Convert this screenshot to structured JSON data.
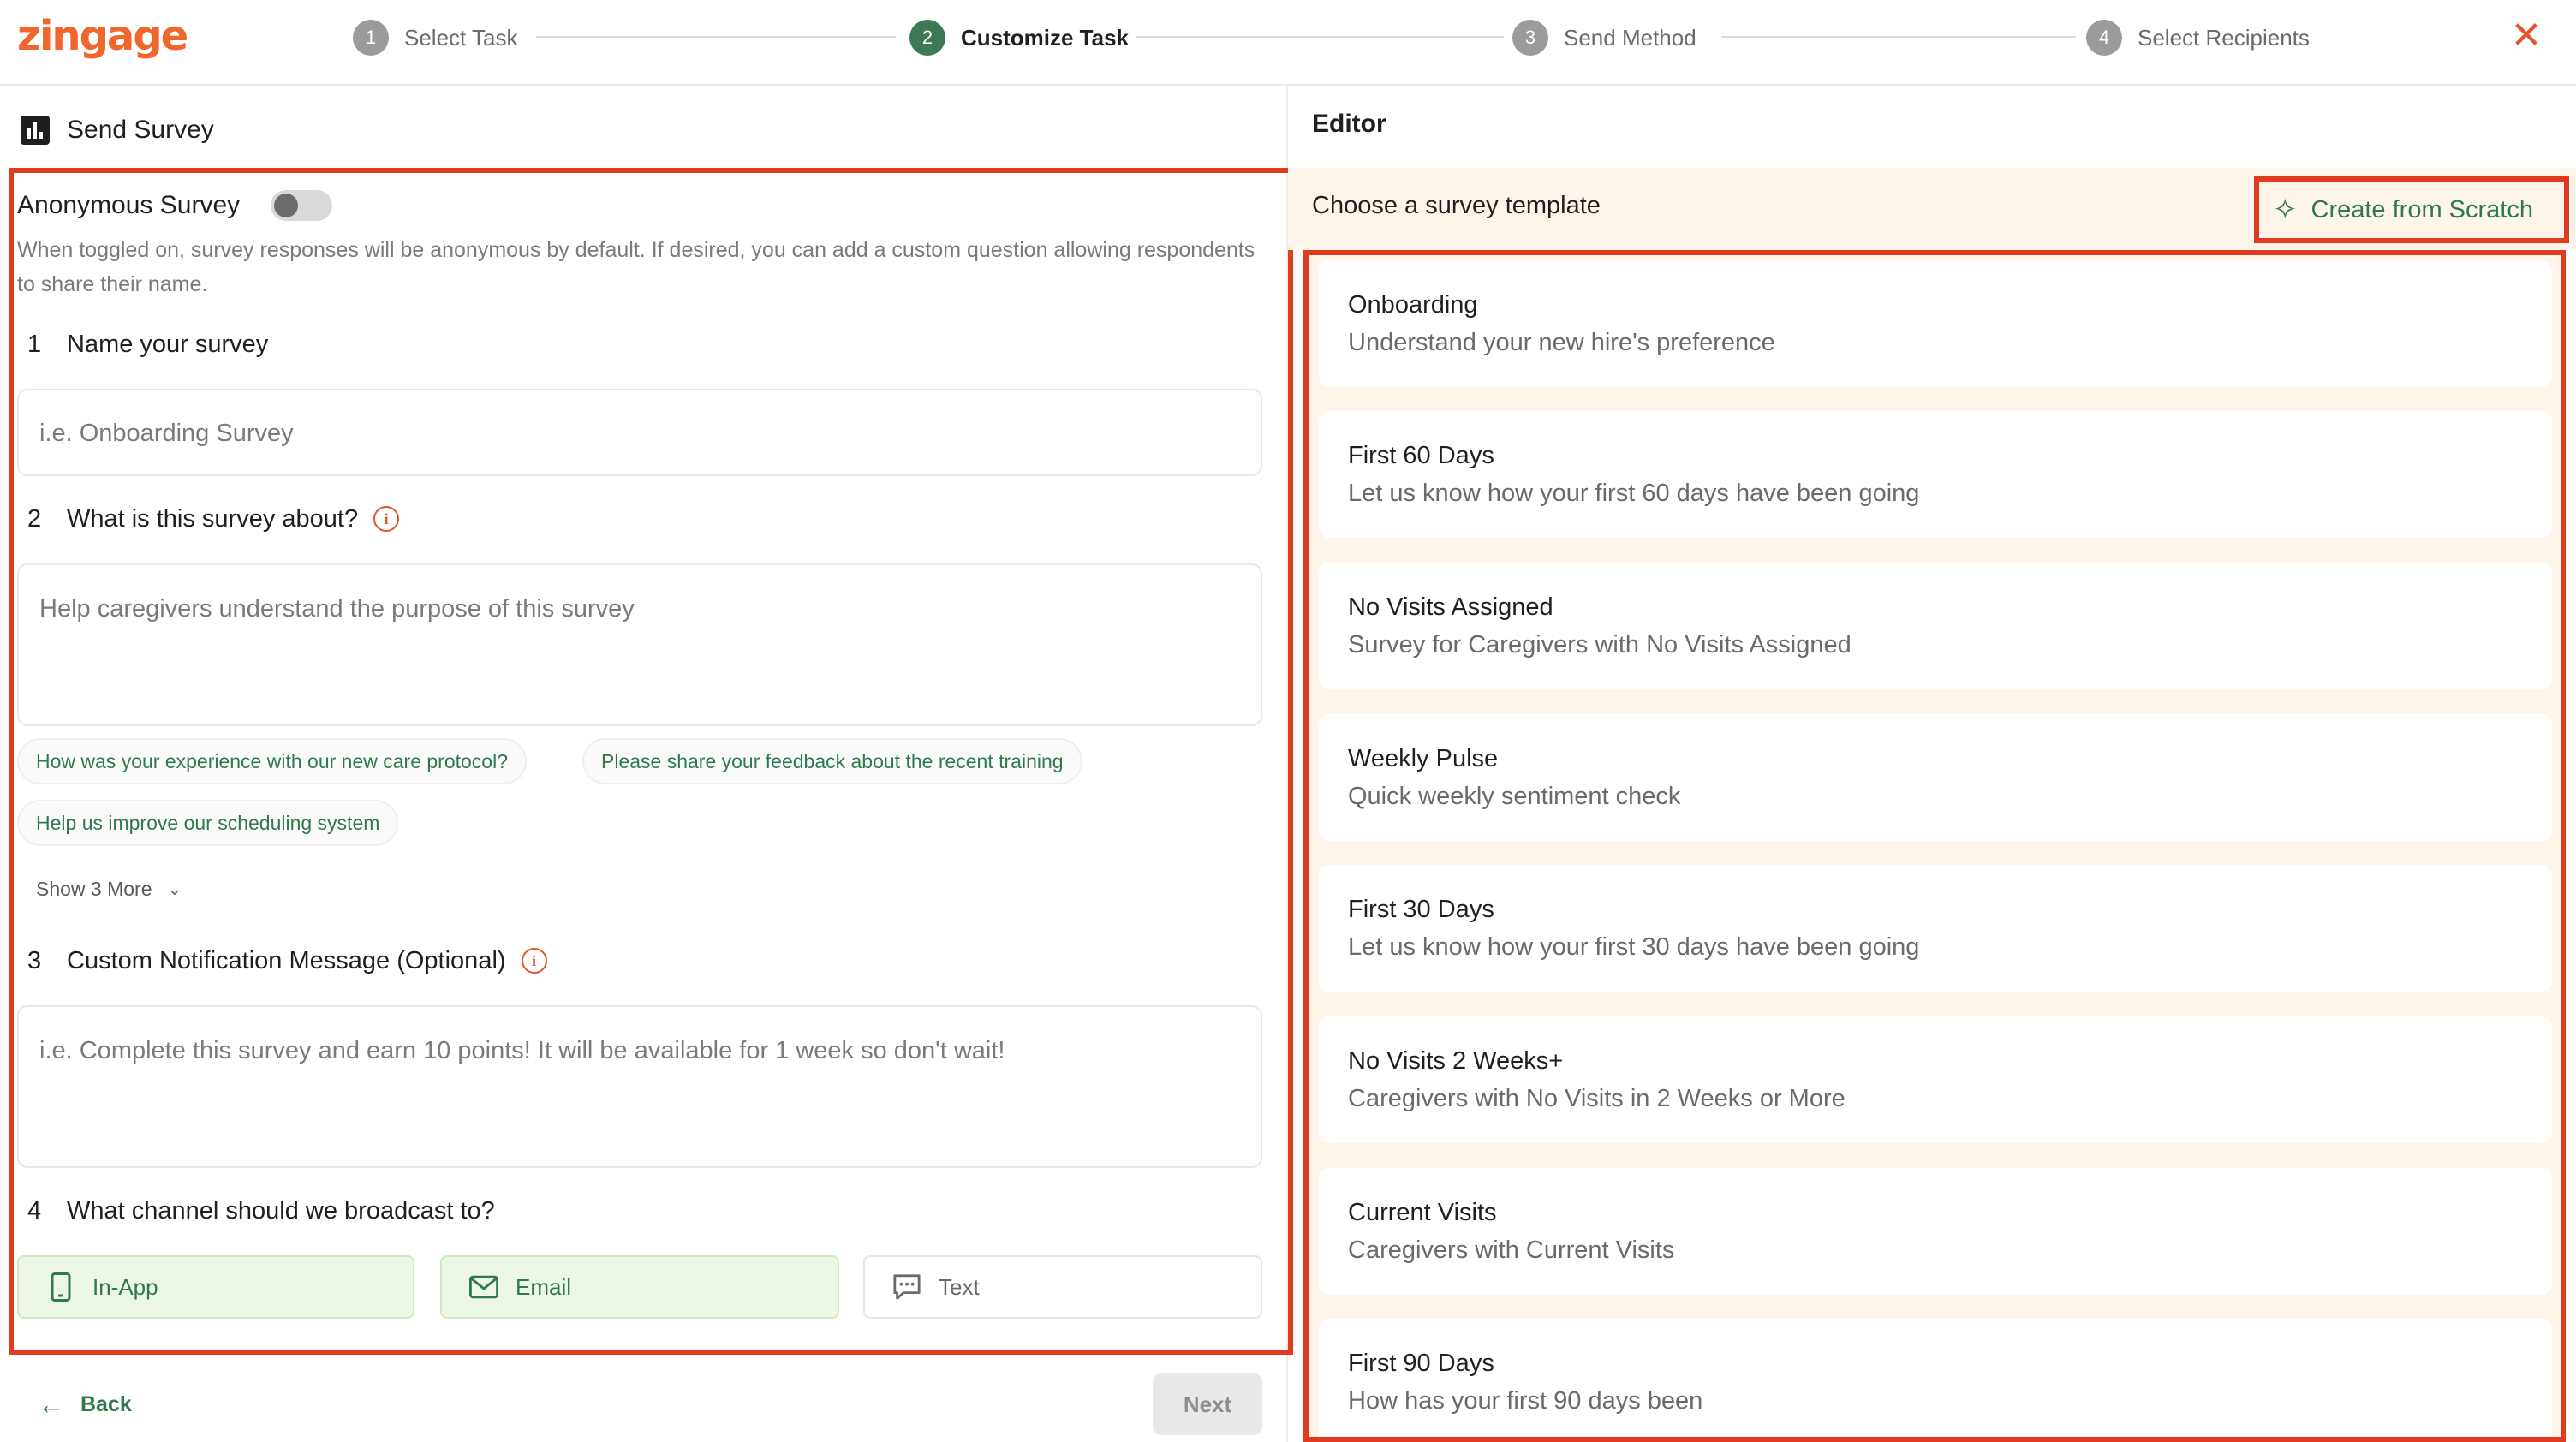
{
  "brand": {
    "logo": "zingage",
    "accent": "#f0662d",
    "green": "#2f7a4c",
    "highlight": "#e03a20"
  },
  "steps": [
    {
      "num": "1",
      "label": "Select Task"
    },
    {
      "num": "2",
      "label": "Customize Task"
    },
    {
      "num": "3",
      "label": "Send Method"
    },
    {
      "num": "4",
      "label": "Select Recipients"
    }
  ],
  "left": {
    "title": "Send Survey",
    "anonymous": {
      "label": "Anonymous Survey",
      "enabled": false,
      "description": "When toggled on, survey responses will be anonymous by default. If desired, you can add a custom question allowing respondents to share their name."
    },
    "q1": {
      "num": "1",
      "label": "Name your survey",
      "placeholder": "i.e. Onboarding Survey"
    },
    "q2": {
      "num": "2",
      "label": "What is this survey about?",
      "placeholder": "Help caregivers understand the purpose of this survey"
    },
    "suggestions": [
      "How was your experience with our new care protocol?",
      "Please share your feedback about the recent training",
      "Help us improve our scheduling system"
    ],
    "show_more": "Show 3 More",
    "q3": {
      "num": "3",
      "label": "Custom Notification Message (Optional)",
      "placeholder": "i.e. Complete this survey and earn 10 points! It will be available for 1 week so don't wait!"
    },
    "q4": {
      "num": "4",
      "label": "What channel should we broadcast to?"
    },
    "channels": [
      {
        "label": "In-App",
        "icon": "phone-icon",
        "selected": true
      },
      {
        "label": "Email",
        "icon": "mail-icon",
        "selected": true
      },
      {
        "label": "Text",
        "icon": "chat-icon",
        "selected": false
      }
    ],
    "back_label": "Back",
    "next_label": "Next"
  },
  "right": {
    "title": "Editor",
    "choose_label": "Choose a survey template",
    "create_label": "Create from Scratch",
    "templates": [
      {
        "title": "Onboarding",
        "subtitle": "Understand your new hire's preference"
      },
      {
        "title": "First 60 Days",
        "subtitle": "Let us know how your first 60 days have been going"
      },
      {
        "title": "No Visits Assigned",
        "subtitle": "Survey for Caregivers with No Visits Assigned"
      },
      {
        "title": "Weekly Pulse",
        "subtitle": "Quick weekly sentiment check"
      },
      {
        "title": "First 30 Days",
        "subtitle": "Let us know how your first 30 days have been going"
      },
      {
        "title": "No Visits 2 Weeks+",
        "subtitle": "Caregivers with No Visits in 2 Weeks or More"
      },
      {
        "title": "Current Visits",
        "subtitle": "Caregivers with Current Visits"
      },
      {
        "title": "First 90 Days",
        "subtitle": "How has your first 90 days been"
      }
    ]
  }
}
